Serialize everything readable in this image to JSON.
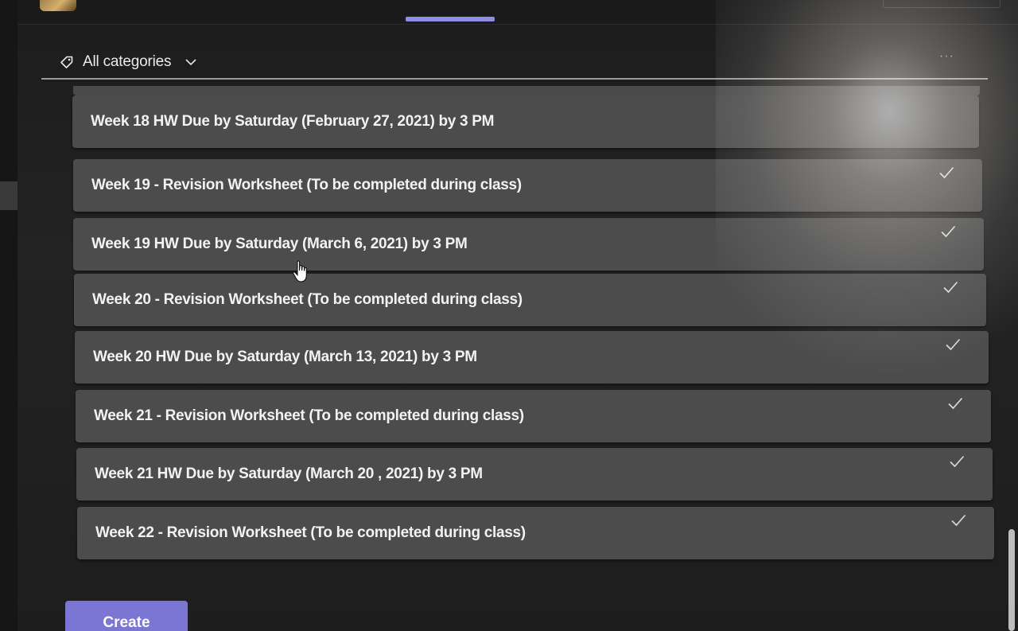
{
  "filter": {
    "label": "All categories",
    "tag_icon": "tag-icon",
    "chevron_icon": "chevron-down-icon",
    "more_icon": "more-options-icon",
    "more_glyph": "···"
  },
  "assignments": [
    {
      "title": "Week 18 HW Due by Saturday (February 27, 2021) by 3 PM",
      "completed": false
    },
    {
      "title": "Week 19 - Revision Worksheet (To be completed during class)",
      "completed": true
    },
    {
      "title": "Week 19 HW Due by Saturday (March 6, 2021) by 3 PM",
      "completed": true
    },
    {
      "title": "Week 20 - Revision Worksheet (To be completed during class)",
      "completed": true
    },
    {
      "title": "Week 20 HW Due by Saturday (March 13, 2021) by 3 PM",
      "completed": true
    },
    {
      "title": "Week 21 - Revision Worksheet (To be completed during class)",
      "completed": true
    },
    {
      "title": "Week 21 HW Due by Saturday (March 20 , 2021) by 3 PM",
      "completed": true
    },
    {
      "title": "Week 22 - Revision Worksheet (To be completed during class)",
      "completed": true
    }
  ],
  "actions": {
    "create_label": "Create"
  },
  "colors": {
    "accent": "#7b76d4",
    "tab_indicator": "#8f8de0",
    "row_background": "#4c4c4c",
    "text": "#f2f2f2"
  }
}
